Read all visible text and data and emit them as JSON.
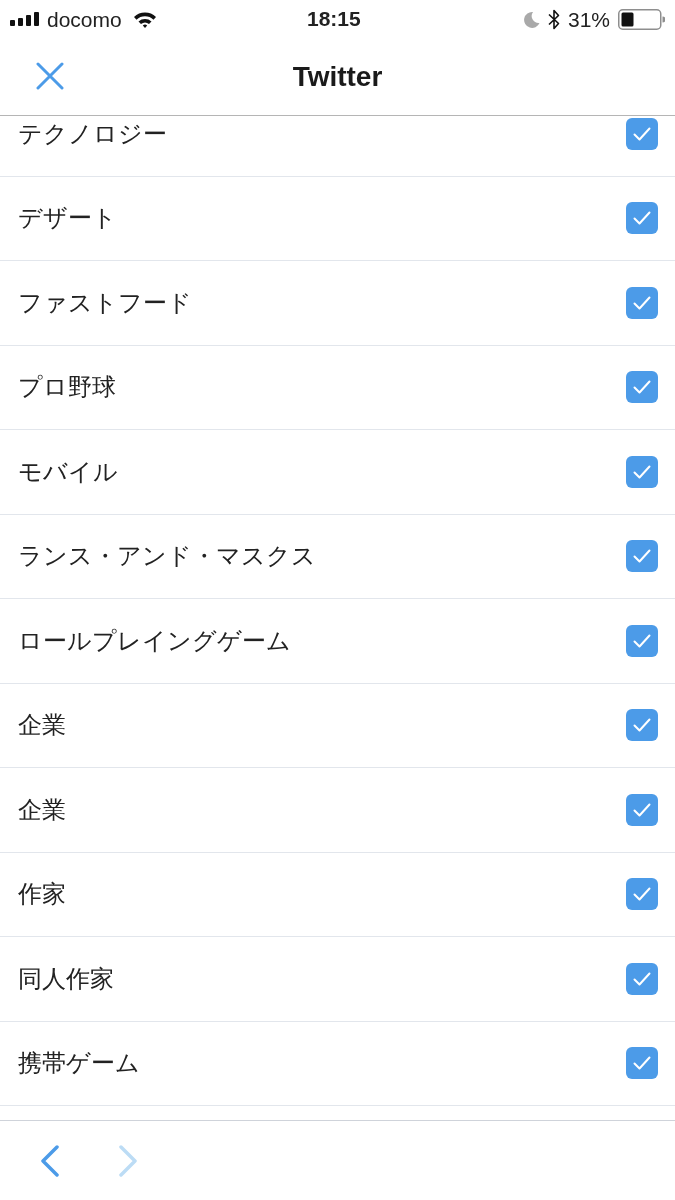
{
  "status_bar": {
    "carrier": "docomo",
    "time": "18:15",
    "battery": "31%"
  },
  "nav_bar": {
    "title": "Twitter"
  },
  "items": [
    {
      "label": "テクノロジー",
      "checked": true
    },
    {
      "label": "デザート",
      "checked": true
    },
    {
      "label": "ファストフード",
      "checked": true
    },
    {
      "label": "プロ野球",
      "checked": true
    },
    {
      "label": "モバイル",
      "checked": true
    },
    {
      "label": "ランス・アンド・マスクス",
      "checked": true
    },
    {
      "label": "ロールプレイングゲーム",
      "checked": true
    },
    {
      "label": "企業",
      "checked": true
    },
    {
      "label": "企業",
      "checked": true
    },
    {
      "label": "作家",
      "checked": true
    },
    {
      "label": "同人作家",
      "checked": true
    },
    {
      "label": "携帯ゲーム",
      "checked": true
    }
  ],
  "toolbar": {
    "back": {
      "disabled": false
    },
    "forward": {
      "disabled": true
    }
  }
}
